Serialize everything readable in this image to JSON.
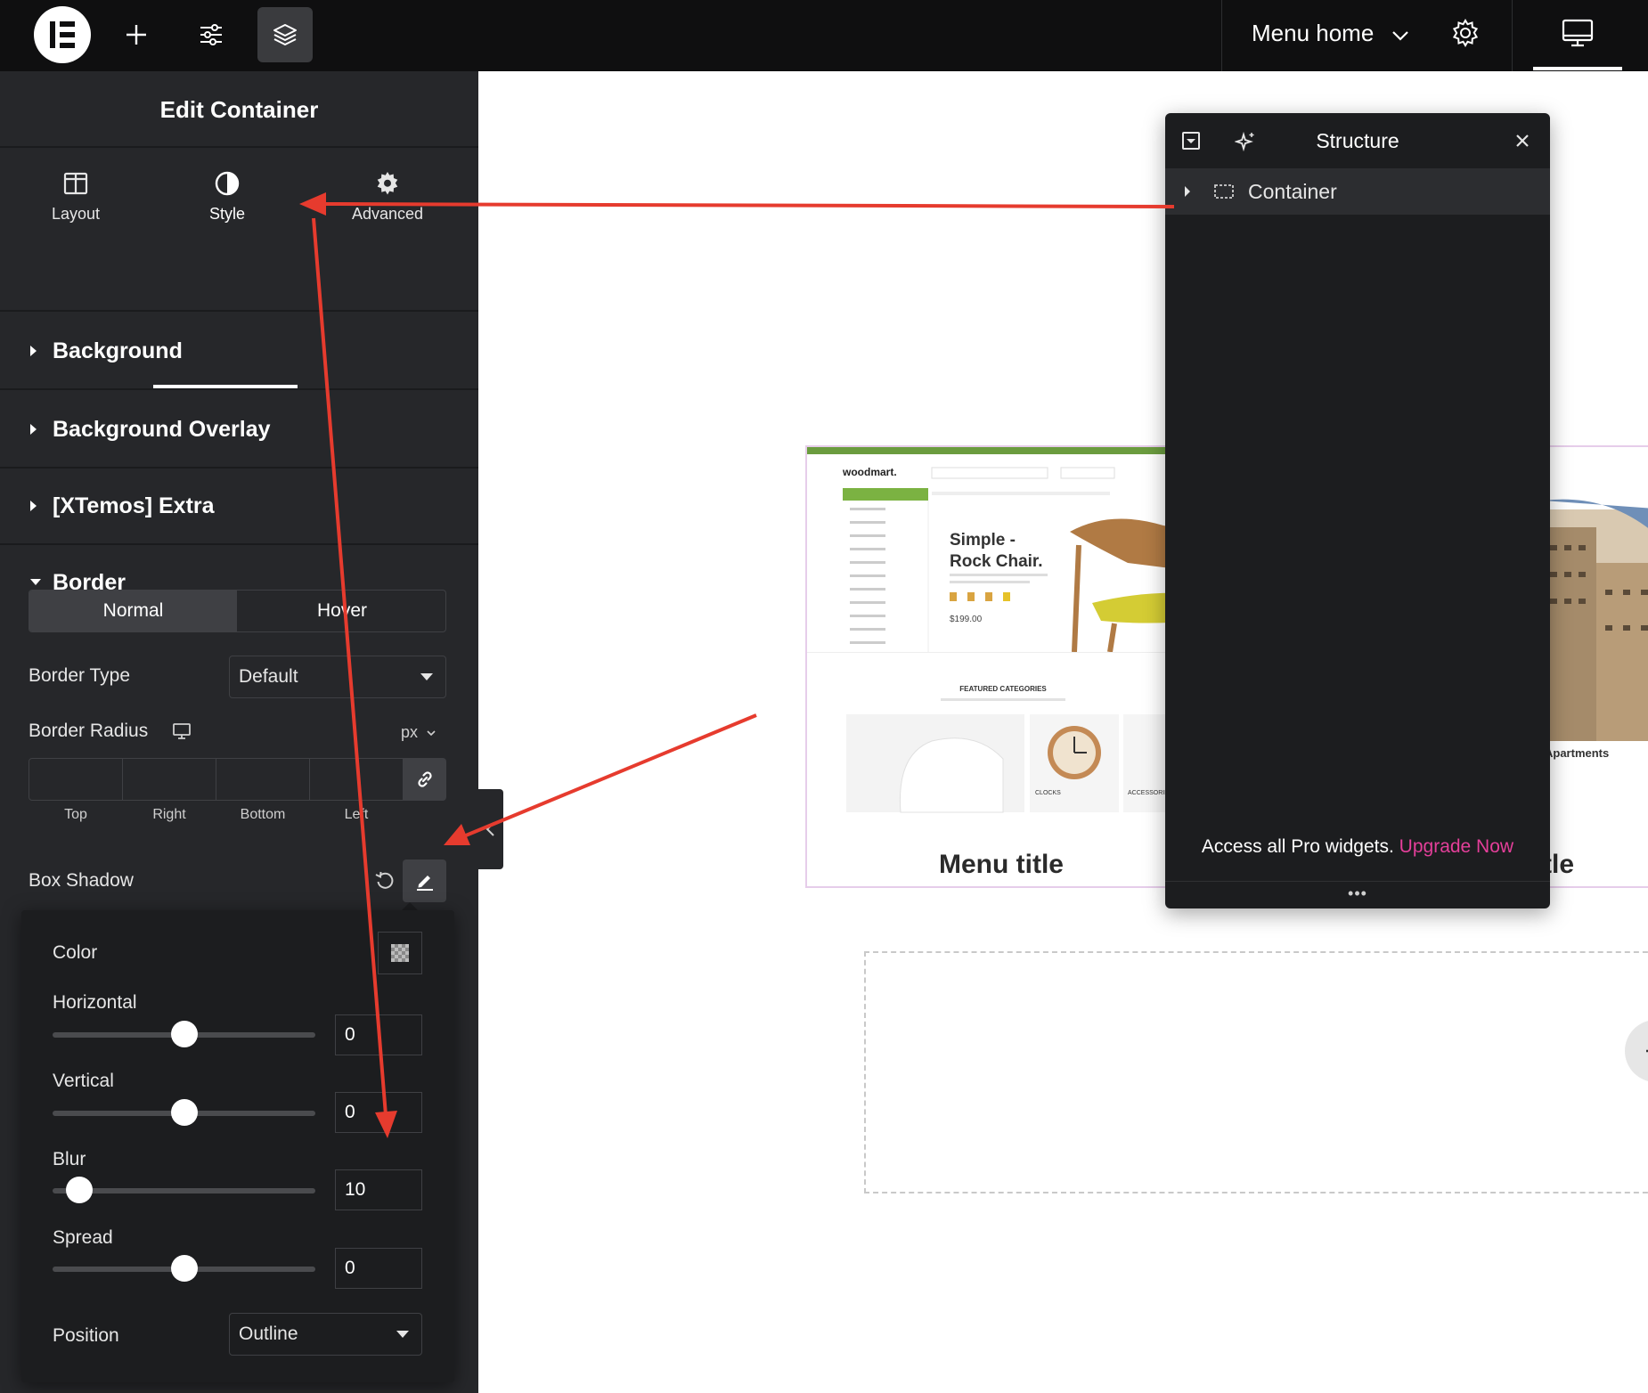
{
  "topbar": {
    "page_title": "Menu home"
  },
  "panel": {
    "title": "Edit Container",
    "tabs": [
      {
        "label": "Layout",
        "icon": "columns-icon"
      },
      {
        "label": "Style",
        "icon": "half-circle-icon"
      },
      {
        "label": "Advanced",
        "icon": "gear-icon"
      }
    ],
    "sections": {
      "background": "Background",
      "background_overlay": "Background Overlay",
      "xtemos_extra": "[XTemos] Extra",
      "border": "Border"
    },
    "border": {
      "state_normal": "Normal",
      "state_hover": "Hover",
      "border_type_label": "Border Type",
      "border_type_value": "Default",
      "border_radius_label": "Border Radius",
      "unit": "px",
      "dims": [
        "Top",
        "Right",
        "Bottom",
        "Left"
      ],
      "box_shadow_label": "Box Shadow"
    },
    "shadow": {
      "color_label": "Color",
      "horizontal_label": "Horizontal",
      "horizontal_value": "0",
      "vertical_label": "Vertical",
      "vertical_value": "0",
      "blur_label": "Blur",
      "blur_value": "10",
      "spread_label": "Spread",
      "spread_value": "0",
      "position_label": "Position",
      "position_value": "Outline"
    }
  },
  "canvas": {
    "card_title": "Menu title",
    "card2_title_partial": "tle",
    "preview": {
      "logo": "woodmart.",
      "hero_title_line1": "Simple -",
      "hero_title_line2": "Rock Chair.",
      "price": "$199.00",
      "featured": "FEATURED CATEGORIES",
      "cat1": "CLOCKS",
      "cat2": "ACCESSORIES",
      "apartments": "Apartments"
    }
  },
  "structure": {
    "title": "Structure",
    "item": "Container",
    "footer_text": "Access all Pro widgets.",
    "footer_link": "Upgrade Now"
  },
  "annotation_color": "#e63b2e"
}
